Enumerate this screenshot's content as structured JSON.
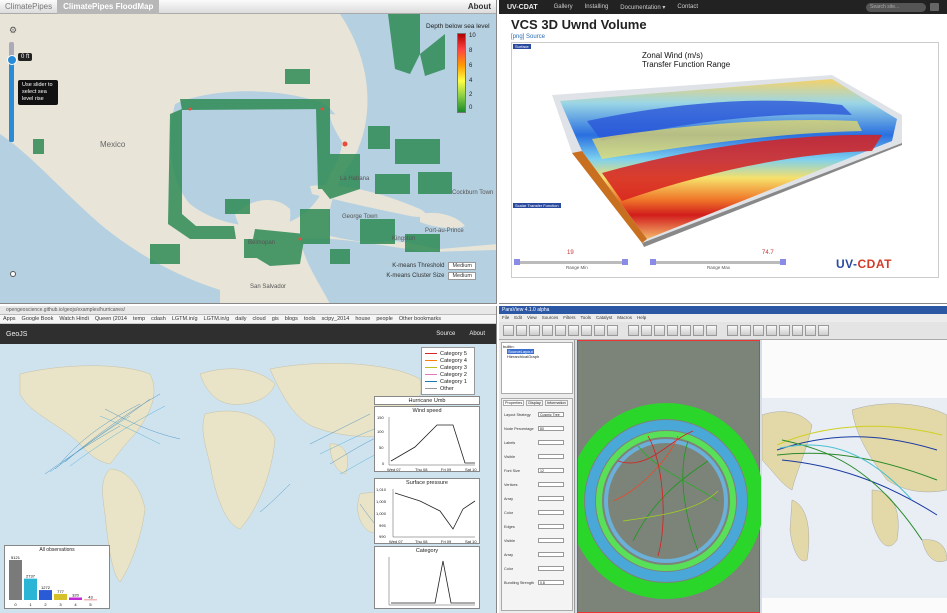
{
  "q1": {
    "brand": "ClimatePipes",
    "tab": "ClimatePipes FloodMap",
    "about": "About",
    "sea_level_label": "0 ft",
    "tooltip": "Use slider to select sea level rise",
    "legend_title": "Depth below sea level",
    "legend_ticks": [
      "10",
      "8",
      "6",
      "4",
      "2",
      "0"
    ],
    "kmeans_threshold_label": "K-means Threshold",
    "kmeans_cluster_label": "K-means Cluster Size",
    "threshold_value": "Medium",
    "cluster_value": "Medium",
    "map_labels": [
      "Mexico",
      "Cuba",
      "La Habana",
      "Belmopan",
      "Cockburn Town",
      "Port-au-Prince",
      "George Town",
      "Kingston",
      "San Salvador"
    ]
  },
  "q2": {
    "logo": "UV-CDAT",
    "nav": [
      "Gallery",
      "Installing",
      "Documentation ▾",
      "Contact"
    ],
    "search_placeholder": "Search site...",
    "title": "VCS 3D Uwnd Volume",
    "source_link": "[png] Source",
    "tag": "Surface",
    "tag2": "Scalar Transfer Function",
    "vol_title_1": "Zonal Wind (m/s)",
    "vol_title_2": "Transfer Function Range",
    "range_min_value": "19",
    "range_max_value": "74.7",
    "range_min_label": "Range Min",
    "range_max_label": "Range Max",
    "logo_bottom": "UV-CDAT"
  },
  "q3": {
    "url": "opengeoscience.github.io/geojs/examples/hurricanes/",
    "bookmarks": [
      "Apps",
      "Google Book",
      "Watch Hindi",
      "Queen (2014",
      "temp",
      "cdash",
      "LGTM.in/g",
      "LGTM.in/g",
      "daily",
      "cloud",
      "gis",
      "blogs",
      "tools",
      "scipy_2014",
      "house",
      "people",
      "Other bookmarks"
    ],
    "brand": "GeoJS",
    "nav": [
      "Source",
      "About"
    ],
    "legend": [
      {
        "label": "Category 5",
        "color": "#d62728"
      },
      {
        "label": "Category 4",
        "color": "#ff7f0e"
      },
      {
        "label": "Category 3",
        "color": "#bcbd22"
      },
      {
        "label": "Category 2",
        "color": "#e377c2"
      },
      {
        "label": "Category 1",
        "color": "#1f77b4"
      },
      {
        "label": "Other",
        "color": "#999999"
      }
    ],
    "hurricane_tab": "Hurricane Umb",
    "wind_title": "Wind speed",
    "wind_ticks": [
      "150",
      "100",
      "50",
      "0"
    ],
    "pressure_title": "Surface pressure",
    "pressure_ticks": [
      "1,010",
      "1,005",
      "1,000",
      "995",
      "990"
    ],
    "category_title": "Category",
    "x_ticks": [
      "Wed 07",
      "Thu 08",
      "Fri 09",
      "Sat 10"
    ],
    "hist_title": "All observations",
    "hist_categories": [
      "0",
      "1",
      "2",
      "3",
      "4",
      "5"
    ],
    "hist_values": [
      5121,
      2737,
      1272,
      777,
      320,
      43
    ],
    "hist_colors": [
      "#7a7a7a",
      "#2ab5d6",
      "#2a5bd6",
      "#d6c12a",
      "#c22ad6",
      "#d62a2a"
    ]
  },
  "q4": {
    "window_title": "ParaView 4.1.0 alpha",
    "menu": [
      "File",
      "Edit",
      "View",
      "Sources",
      "Filters",
      "Tools",
      "Catalyst",
      "Macros",
      "Help"
    ],
    "pipeline_root": "builtin:",
    "pipeline_items": [
      "SourceLayout",
      "HierarchicalGraph"
    ],
    "tabs": [
      "Properties",
      "Display",
      "Information"
    ],
    "prop_labels": [
      "Layout Strategy",
      "Node Percentage",
      "Labels",
      "Visible",
      "Font Size",
      "Vertices",
      "Array",
      "Color",
      "Edges",
      "Visible",
      "Array",
      "Color",
      "Bundling Strength"
    ],
    "prop_values": [
      "Cosmic Tree",
      "80",
      "",
      "",
      "12",
      "",
      "",
      "",
      "",
      "",
      "",
      "",
      "0.8"
    ]
  }
}
